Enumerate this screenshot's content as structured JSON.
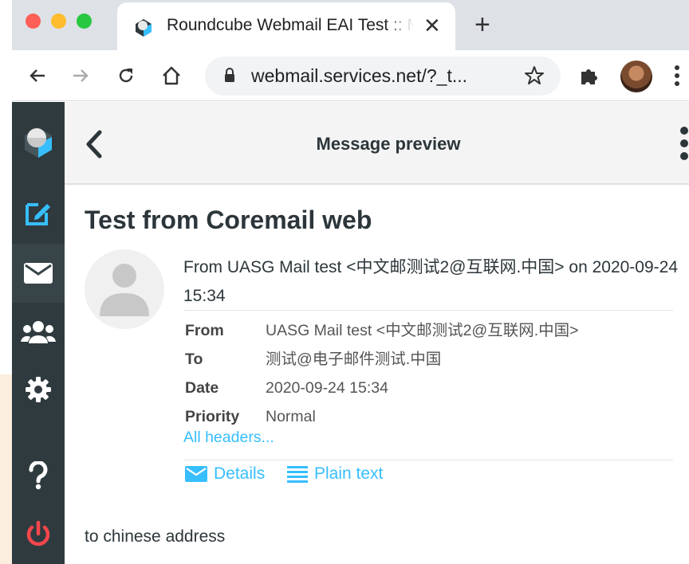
{
  "browser": {
    "tab_title": "Roundcube Webmail EAI Test :: Messa",
    "tab_close": "✕",
    "new_tab": "+",
    "url": "webmail.services.net/?_t..."
  },
  "colors": {
    "accent": "#37beff",
    "sidebar_bg": "#2f3a3f",
    "logout_red": "#f5464c"
  },
  "sidebar": {
    "items": [
      {
        "name": "logo",
        "icon": "roundcube-logo-icon"
      },
      {
        "name": "compose",
        "icon": "compose-icon"
      },
      {
        "name": "mail",
        "icon": "envelope-icon",
        "active": true
      },
      {
        "name": "contacts",
        "icon": "contacts-icon"
      },
      {
        "name": "settings",
        "icon": "gear-icon"
      },
      {
        "name": "help",
        "icon": "help-icon"
      },
      {
        "name": "logout",
        "icon": "power-icon"
      }
    ]
  },
  "header": {
    "title": "Message preview"
  },
  "message": {
    "subject": "Test from Coremail web",
    "summary": "From UASG Mail test <中文邮测试2@互联网.中国> on 2020-09-24 15:34",
    "headers": [
      {
        "label": "From",
        "value": "UASG Mail test <中文邮测试2@互联网.中国>"
      },
      {
        "label": "To",
        "value": "测试@电子邮件测试.中国"
      },
      {
        "label": "Date",
        "value": "2020-09-24 15:34"
      },
      {
        "label": "Priority",
        "value": "Normal"
      }
    ],
    "all_headers_link": "All headers...",
    "details_label": "Details",
    "plain_text_label": "Plain text",
    "body": "to chinese address"
  }
}
